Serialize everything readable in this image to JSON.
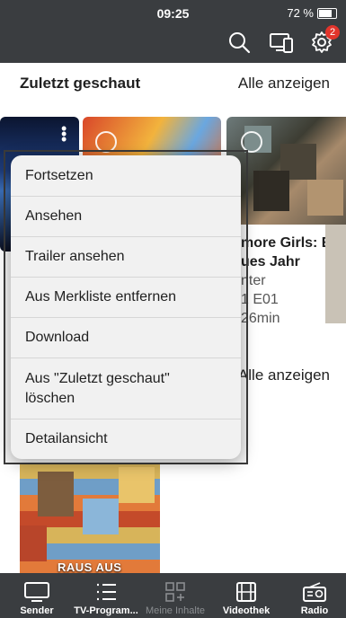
{
  "status": {
    "time": "09:25",
    "battery": "72 %"
  },
  "header": {
    "notification_count": "2"
  },
  "section": {
    "title": "Zuletzt geschaut",
    "link": "Alle anzeigen"
  },
  "background": {
    "card_title_line1": "more Girls: Ein",
    "card_title_line2": "ues Jahr",
    "card_meta_line1": "nter",
    "card_meta_line2": "1 E01",
    "card_meta_line3": " 26min",
    "second_link": "Alle anzeigen",
    "poster_text": "RAUS AUS"
  },
  "menu": {
    "items": [
      "Fortsetzen",
      "Ansehen",
      "Trailer ansehen",
      "Aus Merkliste entfernen",
      "Download",
      "Aus \"Zuletzt geschaut\" löschen",
      "Detailansicht"
    ]
  },
  "tabs": [
    {
      "label": "Sender",
      "icon": "tv-icon",
      "enabled": true
    },
    {
      "label": "TV-Program...",
      "icon": "list-icon",
      "enabled": true
    },
    {
      "label": "Meine Inhalte",
      "icon": "grid-add-icon",
      "enabled": false
    },
    {
      "label": "Videothek",
      "icon": "film-icon",
      "enabled": true
    },
    {
      "label": "Radio",
      "icon": "radio-icon",
      "enabled": true
    }
  ]
}
